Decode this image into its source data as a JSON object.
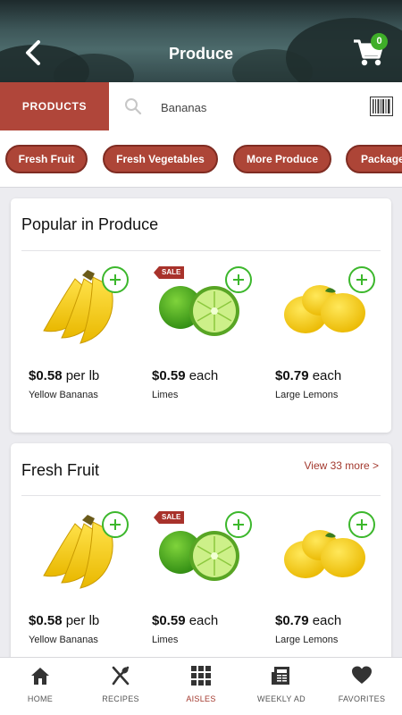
{
  "header": {
    "title": "Produce",
    "cart_count": "0",
    "back_icon": "chevron-left-icon",
    "cart_icon": "cart-icon"
  },
  "search": {
    "products_tab": "PRODUCTS",
    "value": "Bananas",
    "placeholder": "Search"
  },
  "chips": [
    "Fresh Fruit",
    "Fresh Vegetables",
    "More Produce",
    "Packaged"
  ],
  "sections": [
    {
      "title": "Popular in Produce",
      "view_more": "",
      "products": [
        {
          "price": "$0.58",
          "unit": "per lb",
          "name": "Yellow Bananas",
          "sale": "",
          "image": "bananas"
        },
        {
          "price": "$0.59",
          "unit": "each",
          "name": "Limes",
          "sale": "SALE",
          "image": "limes"
        },
        {
          "price": "$0.79",
          "unit": "each",
          "name": "Large Lemons",
          "sale": "",
          "image": "lemons"
        }
      ]
    },
    {
      "title": "Fresh Fruit",
      "view_more": "View 33 more >",
      "products": [
        {
          "price": "$0.58",
          "unit": "per lb",
          "name": "Yellow Bananas",
          "sale": "",
          "image": "bananas"
        },
        {
          "price": "$0.59",
          "unit": "each",
          "name": "Limes",
          "sale": "SALE",
          "image": "limes"
        },
        {
          "price": "$0.79",
          "unit": "each",
          "name": "Large Lemons",
          "sale": "",
          "image": "lemons"
        }
      ]
    }
  ],
  "nav": [
    {
      "label": "HOME",
      "icon": "home-icon"
    },
    {
      "label": "RECIPES",
      "icon": "utensils-icon"
    },
    {
      "label": "AISLES",
      "icon": "grid-icon"
    },
    {
      "label": "WEEKLY AD",
      "icon": "newspaper-icon"
    },
    {
      "label": "FAVORITES",
      "icon": "heart-icon"
    }
  ],
  "colors": {
    "brand": "#b0463a",
    "accent_green": "#3cb72c",
    "active_nav": "#a3392e"
  }
}
